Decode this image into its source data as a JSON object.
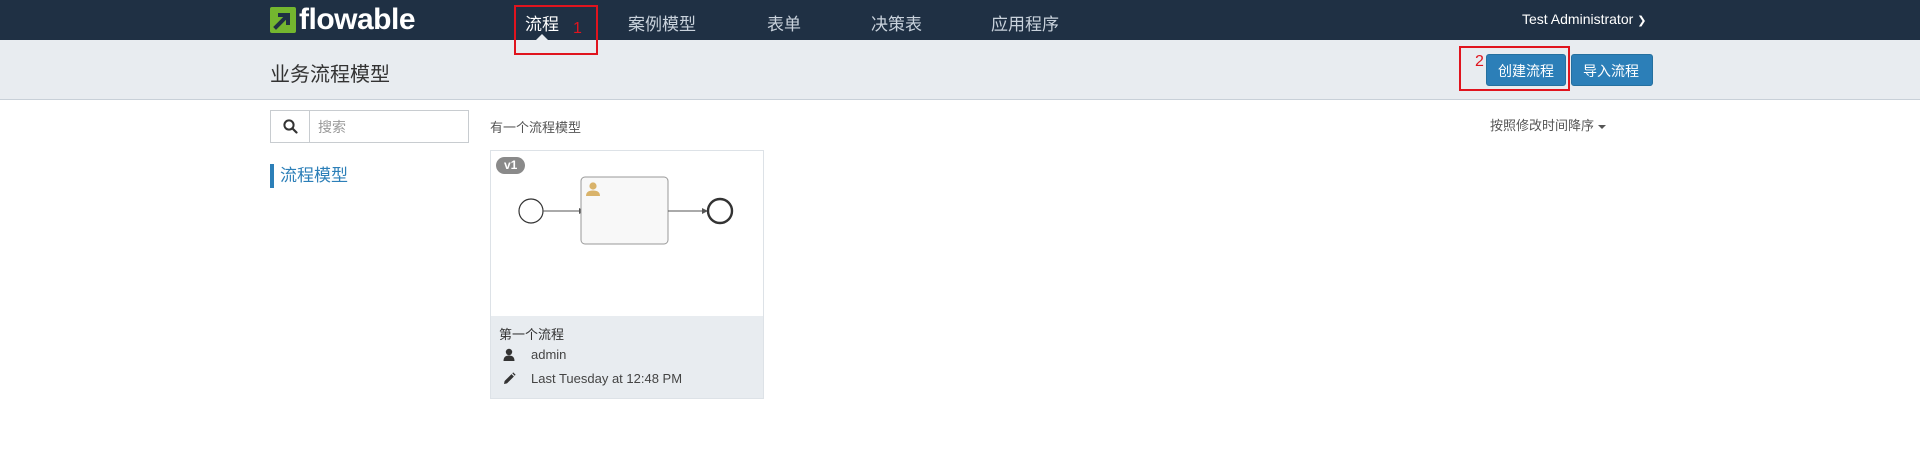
{
  "app": {
    "logo_text": "flowable",
    "brand_color": "#74b62f",
    "nav_bg": "#1f3044"
  },
  "nav": {
    "items": [
      {
        "label": "流程",
        "active": true
      },
      {
        "label": "案例模型"
      },
      {
        "label": "表单"
      },
      {
        "label": "决策表"
      },
      {
        "label": "应用程序"
      }
    ],
    "user": "Test Administrator",
    "user_icon": "chevron-down-icon"
  },
  "header": {
    "title": "业务流程模型",
    "create_button": "创建流程",
    "import_button": "导入流程",
    "button_color": "#2c7fb8"
  },
  "annotations": {
    "box1_number": "1",
    "box2_number": "2",
    "color": "#e0141e"
  },
  "sidebar": {
    "search_placeholder": "搜索",
    "search_icon": "search-icon",
    "filter_label": "流程模型"
  },
  "main": {
    "result_count": "有一个流程模型",
    "sort_label": "按照修改时间降序"
  },
  "models": [
    {
      "version": "v1",
      "name": "第一个流程",
      "owner": "admin",
      "modified": "Last Tuesday at 12:48 PM",
      "owner_icon": "user-icon",
      "modified_icon": "pencil-icon"
    }
  ]
}
